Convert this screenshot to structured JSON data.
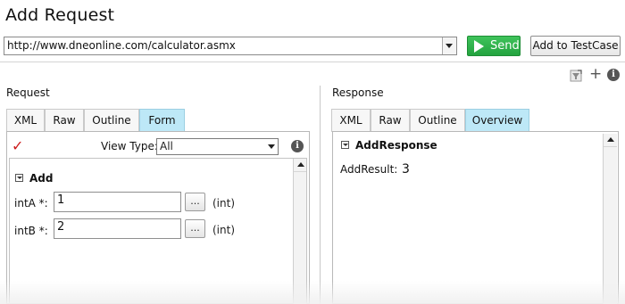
{
  "window": {
    "title": "Add Request"
  },
  "toolbar": {
    "url_value": "http://www.dneonline.com/calculator.asmx",
    "send_label": "Send",
    "add_testcase_label": "Add to TestCase",
    "icons": [
      "filter-icon",
      "plus-icon",
      "info-icon"
    ],
    "accent_send": "#2eb34a"
  },
  "request": {
    "label": "Request",
    "tabs": [
      {
        "label": "XML",
        "active": false
      },
      {
        "label": "Raw",
        "active": false
      },
      {
        "label": "Outline",
        "active": false
      },
      {
        "label": "Form",
        "active": true
      }
    ],
    "view_type_label": "View Type:",
    "view_type_value": "All",
    "operation": "Add",
    "fields": [
      {
        "label": "intA *:",
        "value": "1",
        "button": "...",
        "type": "(int)"
      },
      {
        "label": "intB *:",
        "value": "2",
        "button": "...",
        "type": "(int)"
      }
    ]
  },
  "response": {
    "label": "Response",
    "tabs": [
      {
        "label": "XML",
        "active": false
      },
      {
        "label": "Raw",
        "active": false
      },
      {
        "label": "Outline",
        "active": false
      },
      {
        "label": "Overview",
        "active": true
      }
    ],
    "node": "AddResponse",
    "result_label": "AddResult:",
    "result_value": "3"
  },
  "colors": {
    "active_tab": "#bde8f7",
    "check": "#cc1b1b"
  }
}
